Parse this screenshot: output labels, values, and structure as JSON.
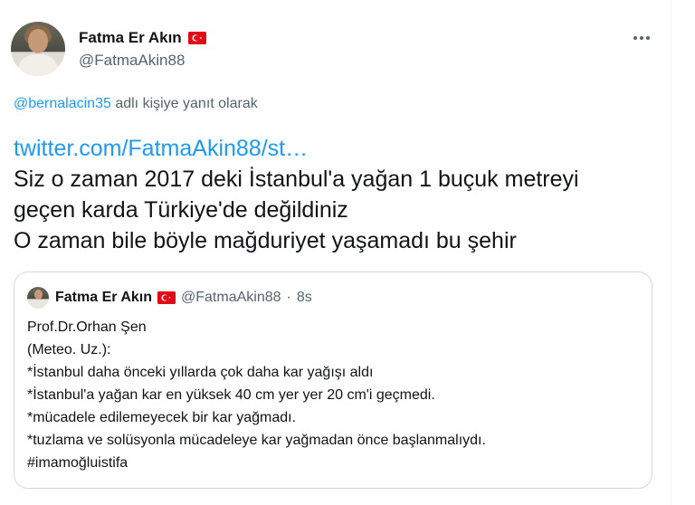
{
  "author": {
    "display_name": "Fatma Er Akın",
    "handle": "@FatmaAkin88",
    "flag_icon": "turkey-flag-icon"
  },
  "more_icon": "more-horizontal-icon",
  "reply": {
    "mention": "@bernalacin35",
    "suffix": " adlı kişiye yanıt olarak"
  },
  "tweet": {
    "link": "twitter.com/FatmaAkin88/st…",
    "lines": [
      "Siz o zaman 2017 deki İstanbul'a yağan 1 buçuk metreyi",
      "geçen karda Türkiye'de değildiniz",
      "O zaman bile böyle mağduriyet yaşamadı bu şehir"
    ]
  },
  "quote": {
    "display_name": "Fatma Er Akın",
    "handle": "@FatmaAkin88",
    "separator": "·",
    "time": "8s",
    "lines": [
      "Prof.Dr.Orhan Şen",
      "(Meteo. Uz.):",
      "*İstanbul daha önceki yıllarda çok daha kar yağışı aldı",
      "*İstanbul'a yağan kar en yüksek 40 cm yer yer 20 cm'i geçmedi.",
      "*mücadele edilemeyecek bir kar yağmadı.",
      "*tuzlama ve solüsyonla mücadeleye kar yağmadan önce başlanmalıydı.",
      "#imamoğluistifa"
    ]
  },
  "colors": {
    "link_blue": "#1d9bf0",
    "secondary_text": "#536471",
    "border": "#cfd9de",
    "flag_red": "#e30a17"
  }
}
